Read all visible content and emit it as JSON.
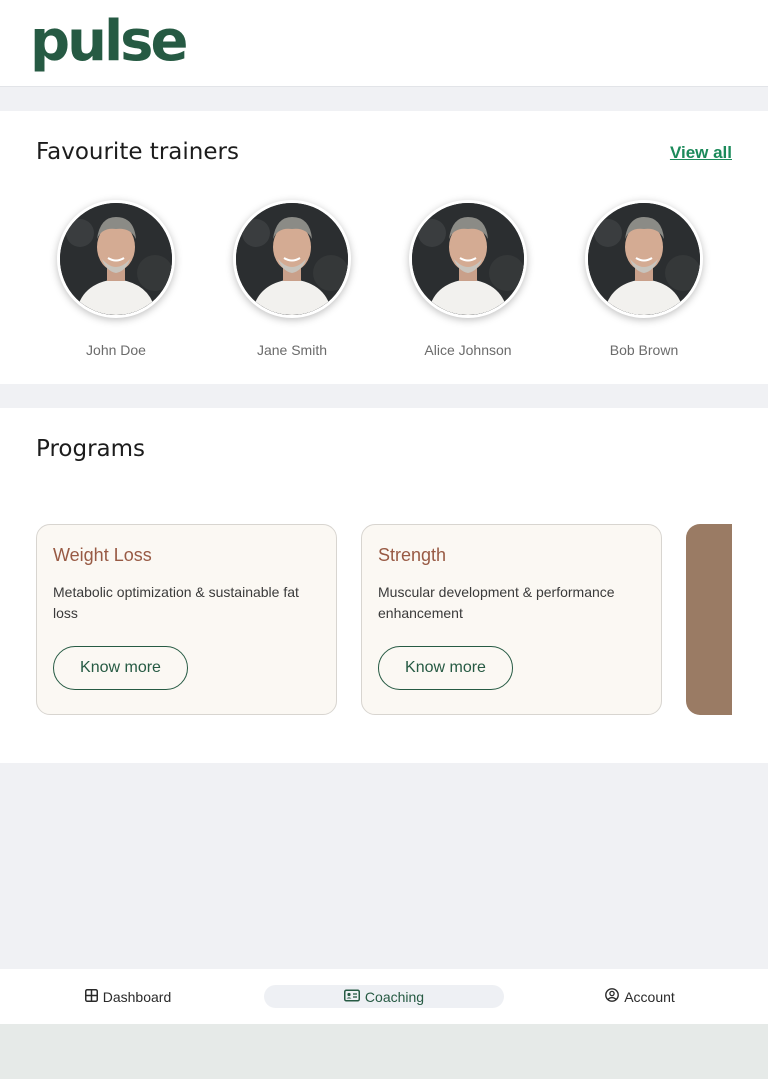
{
  "app": {
    "logo_text": "pulse",
    "brand_color": "#265a43"
  },
  "trainers": {
    "title": "Favourite trainers",
    "view_all_label": "View all",
    "items": [
      {
        "name": "John Doe"
      },
      {
        "name": "Jane Smith"
      },
      {
        "name": "Alice Johnson"
      },
      {
        "name": "Bob Brown"
      }
    ]
  },
  "programs": {
    "title": "Programs",
    "items": [
      {
        "title": "Weight Loss",
        "description": "Metabolic optimization & sustainable fat loss",
        "button_label": "Know more"
      },
      {
        "title": "Strength",
        "description": "Muscular development & performance enhancement",
        "button_label": "Know more"
      }
    ]
  },
  "nav": {
    "items": [
      {
        "label": "Dashboard",
        "icon": "grid-icon"
      },
      {
        "label": "Coaching",
        "icon": "id-card-icon",
        "active": true
      },
      {
        "label": "Account",
        "icon": "user-circle-icon"
      }
    ]
  }
}
